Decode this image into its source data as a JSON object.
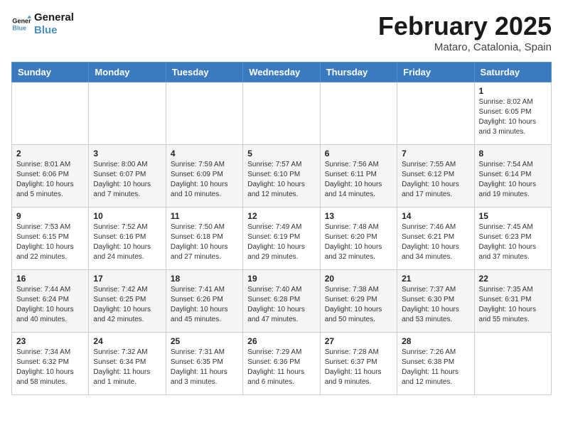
{
  "header": {
    "logo_line1": "General",
    "logo_line2": "Blue",
    "month_title": "February 2025",
    "location": "Mataro, Catalonia, Spain"
  },
  "calendar": {
    "days_of_week": [
      "Sunday",
      "Monday",
      "Tuesday",
      "Wednesday",
      "Thursday",
      "Friday",
      "Saturday"
    ],
    "weeks": [
      [
        {
          "day": "",
          "info": ""
        },
        {
          "day": "",
          "info": ""
        },
        {
          "day": "",
          "info": ""
        },
        {
          "day": "",
          "info": ""
        },
        {
          "day": "",
          "info": ""
        },
        {
          "day": "",
          "info": ""
        },
        {
          "day": "1",
          "info": "Sunrise: 8:02 AM\nSunset: 6:05 PM\nDaylight: 10 hours and 3 minutes."
        }
      ],
      [
        {
          "day": "2",
          "info": "Sunrise: 8:01 AM\nSunset: 6:06 PM\nDaylight: 10 hours and 5 minutes."
        },
        {
          "day": "3",
          "info": "Sunrise: 8:00 AM\nSunset: 6:07 PM\nDaylight: 10 hours and 7 minutes."
        },
        {
          "day": "4",
          "info": "Sunrise: 7:59 AM\nSunset: 6:09 PM\nDaylight: 10 hours and 10 minutes."
        },
        {
          "day": "5",
          "info": "Sunrise: 7:57 AM\nSunset: 6:10 PM\nDaylight: 10 hours and 12 minutes."
        },
        {
          "day": "6",
          "info": "Sunrise: 7:56 AM\nSunset: 6:11 PM\nDaylight: 10 hours and 14 minutes."
        },
        {
          "day": "7",
          "info": "Sunrise: 7:55 AM\nSunset: 6:12 PM\nDaylight: 10 hours and 17 minutes."
        },
        {
          "day": "8",
          "info": "Sunrise: 7:54 AM\nSunset: 6:14 PM\nDaylight: 10 hours and 19 minutes."
        }
      ],
      [
        {
          "day": "9",
          "info": "Sunrise: 7:53 AM\nSunset: 6:15 PM\nDaylight: 10 hours and 22 minutes."
        },
        {
          "day": "10",
          "info": "Sunrise: 7:52 AM\nSunset: 6:16 PM\nDaylight: 10 hours and 24 minutes."
        },
        {
          "day": "11",
          "info": "Sunrise: 7:50 AM\nSunset: 6:18 PM\nDaylight: 10 hours and 27 minutes."
        },
        {
          "day": "12",
          "info": "Sunrise: 7:49 AM\nSunset: 6:19 PM\nDaylight: 10 hours and 29 minutes."
        },
        {
          "day": "13",
          "info": "Sunrise: 7:48 AM\nSunset: 6:20 PM\nDaylight: 10 hours and 32 minutes."
        },
        {
          "day": "14",
          "info": "Sunrise: 7:46 AM\nSunset: 6:21 PM\nDaylight: 10 hours and 34 minutes."
        },
        {
          "day": "15",
          "info": "Sunrise: 7:45 AM\nSunset: 6:23 PM\nDaylight: 10 hours and 37 minutes."
        }
      ],
      [
        {
          "day": "16",
          "info": "Sunrise: 7:44 AM\nSunset: 6:24 PM\nDaylight: 10 hours and 40 minutes."
        },
        {
          "day": "17",
          "info": "Sunrise: 7:42 AM\nSunset: 6:25 PM\nDaylight: 10 hours and 42 minutes."
        },
        {
          "day": "18",
          "info": "Sunrise: 7:41 AM\nSunset: 6:26 PM\nDaylight: 10 hours and 45 minutes."
        },
        {
          "day": "19",
          "info": "Sunrise: 7:40 AM\nSunset: 6:28 PM\nDaylight: 10 hours and 47 minutes."
        },
        {
          "day": "20",
          "info": "Sunrise: 7:38 AM\nSunset: 6:29 PM\nDaylight: 10 hours and 50 minutes."
        },
        {
          "day": "21",
          "info": "Sunrise: 7:37 AM\nSunset: 6:30 PM\nDaylight: 10 hours and 53 minutes."
        },
        {
          "day": "22",
          "info": "Sunrise: 7:35 AM\nSunset: 6:31 PM\nDaylight: 10 hours and 55 minutes."
        }
      ],
      [
        {
          "day": "23",
          "info": "Sunrise: 7:34 AM\nSunset: 6:32 PM\nDaylight: 10 hours and 58 minutes."
        },
        {
          "day": "24",
          "info": "Sunrise: 7:32 AM\nSunset: 6:34 PM\nDaylight: 11 hours and 1 minute."
        },
        {
          "day": "25",
          "info": "Sunrise: 7:31 AM\nSunset: 6:35 PM\nDaylight: 11 hours and 3 minutes."
        },
        {
          "day": "26",
          "info": "Sunrise: 7:29 AM\nSunset: 6:36 PM\nDaylight: 11 hours and 6 minutes."
        },
        {
          "day": "27",
          "info": "Sunrise: 7:28 AM\nSunset: 6:37 PM\nDaylight: 11 hours and 9 minutes."
        },
        {
          "day": "28",
          "info": "Sunrise: 7:26 AM\nSunset: 6:38 PM\nDaylight: 11 hours and 12 minutes."
        },
        {
          "day": "",
          "info": ""
        }
      ]
    ]
  }
}
